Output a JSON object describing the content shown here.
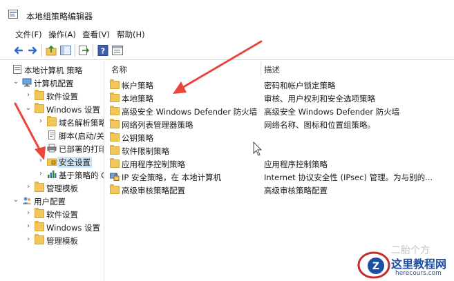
{
  "window": {
    "title": "本地组策略编辑器"
  },
  "menu": [
    "文件(F)",
    "操作(A)",
    "查看(V)",
    "帮助(H)"
  ],
  "toolbar": {
    "icons": [
      "back-icon",
      "forward-icon",
      "up-folder-icon",
      "show-tree-icon",
      "export-icon",
      "help-icon",
      "properties-icon"
    ]
  },
  "tree": [
    {
      "label": "本地计算机 策略",
      "icon": "computer-policy-icon",
      "chev": "",
      "level": 0
    },
    {
      "label": "计算机配置",
      "icon": "computer-icon",
      "chev": "v",
      "level": 1
    },
    {
      "label": "软件设置",
      "icon": "folder-icon",
      "chev": ">",
      "level": 2
    },
    {
      "label": "Windows 设置",
      "icon": "folder-icon",
      "chev": "v",
      "level": 2
    },
    {
      "label": "域名解析策略",
      "icon": "folder-icon",
      "chev": ">",
      "level": 3
    },
    {
      "label": "脚本(启动/关",
      "icon": "script-icon",
      "chev": "",
      "level": 3
    },
    {
      "label": "已部署的打印",
      "icon": "printer-icon",
      "chev": "",
      "level": 3
    },
    {
      "label": "安全设置",
      "icon": "security-folder-icon",
      "chev": ">",
      "level": 3,
      "selected": true
    },
    {
      "label": "基于策略的 C",
      "icon": "chart-icon",
      "chev": ">",
      "level": 3
    },
    {
      "label": "管理模板",
      "icon": "folder-icon",
      "chev": ">",
      "level": 2
    },
    {
      "label": "用户配置",
      "icon": "users-icon",
      "chev": "v",
      "level": 1
    },
    {
      "label": "软件设置",
      "icon": "folder-icon",
      "chev": ">",
      "level": 2
    },
    {
      "label": "Windows 设置",
      "icon": "folder-icon",
      "chev": ">",
      "level": 2
    },
    {
      "label": "管理模板",
      "icon": "folder-icon",
      "chev": ">",
      "level": 2
    }
  ],
  "columns": {
    "name": "名称",
    "desc": "描述"
  },
  "items": [
    {
      "name": "帐户策略",
      "desc": "密码和帐户锁定策略",
      "icon": "folder-icon"
    },
    {
      "name": "本地策略",
      "desc": "审核、用户权利和安全选项策略",
      "icon": "folder-icon"
    },
    {
      "name": "高级安全 Windows Defender 防火墙",
      "desc": "高级安全 Windows Defender 防火墙",
      "icon": "folder-icon"
    },
    {
      "name": "网络列表管理器策略",
      "desc": "网络名称、图标和位置组策略。",
      "icon": "folder-icon"
    },
    {
      "name": "公钥策略",
      "desc": "",
      "icon": "folder-icon"
    },
    {
      "name": "软件限制策略",
      "desc": "",
      "icon": "folder-icon"
    },
    {
      "name": "应用程序控制策略",
      "desc": "应用程序控制策略",
      "icon": "folder-icon"
    },
    {
      "name": "IP 安全策略，在 本地计算机",
      "desc": "Internet 协议安全性 (IPsec) 管理。为与别的...",
      "icon": "ip-security-icon"
    },
    {
      "name": "高级审核策略配置",
      "desc": "高级审核策略配置",
      "icon": "folder-icon"
    }
  ],
  "watermark": {
    "line1": "这里教程网",
    "line2": "herecours.com",
    "faint": "二胎个方"
  },
  "colors": {
    "selection": "#cce4f7",
    "folder": "#f1c75b",
    "arrow": "#e8463c",
    "watermark": "#1a4fa3"
  }
}
